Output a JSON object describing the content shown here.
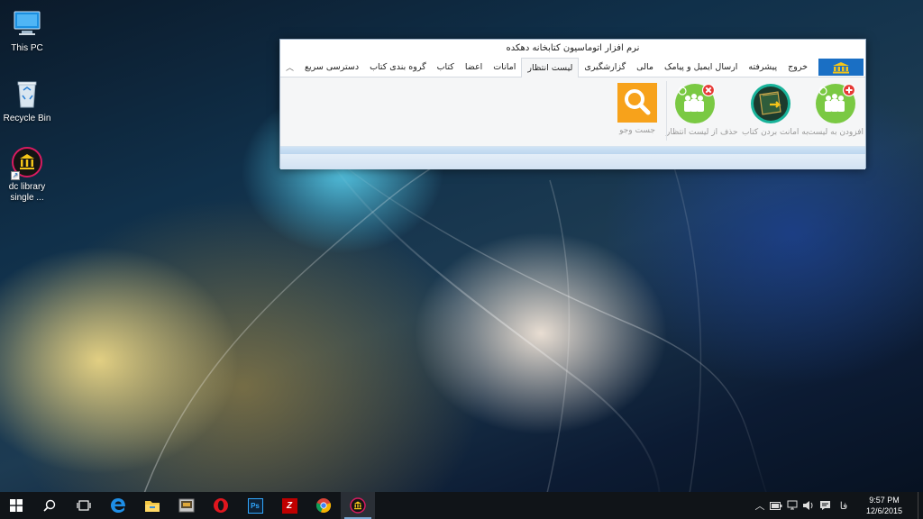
{
  "desktop": {
    "icons": [
      {
        "label": "This PC"
      },
      {
        "label": "Recycle Bin"
      },
      {
        "label": "dc library single ..."
      }
    ]
  },
  "window": {
    "title": "نرم افزار اتوماسیون کتابخانه دهکده",
    "tabs": [
      {
        "label": "دسترسی سریع"
      },
      {
        "label": "گروه بندی کتاب"
      },
      {
        "label": "کتاب"
      },
      {
        "label": "اعضا"
      },
      {
        "label": "امانات"
      },
      {
        "label": "لیست انتظار"
      },
      {
        "label": "گزارشگیری"
      },
      {
        "label": "مالی"
      },
      {
        "label": "ارسال ایمیل و پیامک"
      },
      {
        "label": "پیشرفته"
      },
      {
        "label": "خروج"
      }
    ],
    "active_tab": "لیست انتظار",
    "collapse_icon": "chevron-up-icon",
    "ribbon": {
      "buttons": [
        {
          "label": "افزودن به لیست",
          "icon": "add-to-waitlist-icon"
        },
        {
          "label": "به امانت بردن کتاب",
          "icon": "lend-book-icon"
        },
        {
          "label": "حذف از لیست انتظار",
          "icon": "remove-from-waitlist-icon"
        },
        {
          "label": "جست وجو",
          "icon": "search-icon"
        }
      ]
    }
  },
  "taskbar": {
    "apps": [
      "start-icon",
      "search-icon",
      "task-view-icon",
      "edge-icon",
      "file-explorer-icon",
      "app-icon",
      "opera-icon",
      "photoshop-icon",
      "filezilla-icon",
      "chrome-icon",
      "dc-library-icon"
    ],
    "language": "فا",
    "time": "9:57 PM",
    "date": "12/6/2015"
  },
  "colors": {
    "accent": "#1a6fc4",
    "green": "#7ac943",
    "orange": "#f7a21b",
    "red": "#e53935"
  }
}
